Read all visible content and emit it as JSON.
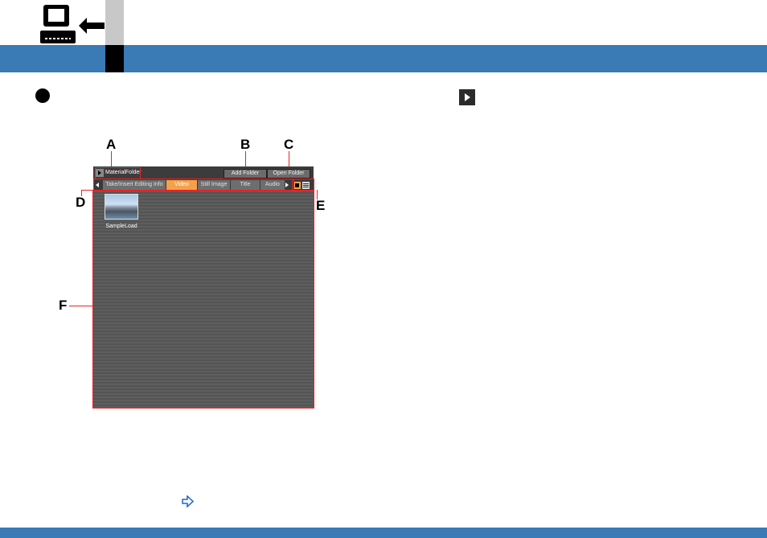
{
  "page": {
    "header_color": "#3a7ab5",
    "footer_color": "#3a7ab5",
    "icons": [
      "computer-input-icon",
      "bullet-icon",
      "play-square-icon",
      "link-arrow-icon"
    ]
  },
  "callouts": {
    "a": "A",
    "b": "B",
    "c": "C",
    "d": "D",
    "e": "E",
    "f": "F",
    "highlight_color": "#e0252b"
  },
  "bin": {
    "folder_label": "MaterialFolder",
    "add_folder": "Add Folder",
    "open_folder": "Open Folder",
    "tabs": [
      {
        "label": "Take/Insert Editing Info",
        "active": false
      },
      {
        "label": "Video",
        "active": true
      },
      {
        "label": "Still Image",
        "active": false
      },
      {
        "label": "Title",
        "active": false
      },
      {
        "label": "Audio",
        "active": false
      }
    ],
    "active_tab_color": "#f6a14a",
    "clip": {
      "label": "SampleLoad"
    }
  }
}
